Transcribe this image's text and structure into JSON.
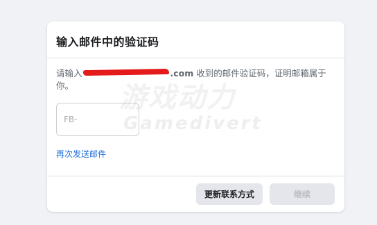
{
  "dialog": {
    "title": "输入邮件中的验证码",
    "message_prefix": "请输入",
    "email_domain": ".com",
    "message_suffix": " 收到的邮件验证码，证明邮箱属于你。",
    "code_placeholder": "FB-",
    "code_value": "",
    "resend_link": "再次发送邮件",
    "update_contact_button": "更新联系方式",
    "continue_button": "继续"
  },
  "watermark": {
    "logo_text": "游戏动力",
    "site_text": "Gamedivert"
  },
  "colors": {
    "page_background": "#f0f2f5",
    "link": "#216fdb",
    "redaction": "#e41b1b",
    "button_secondary": "#e4e6eb",
    "button_disabled_text": "#bcc0c4"
  }
}
